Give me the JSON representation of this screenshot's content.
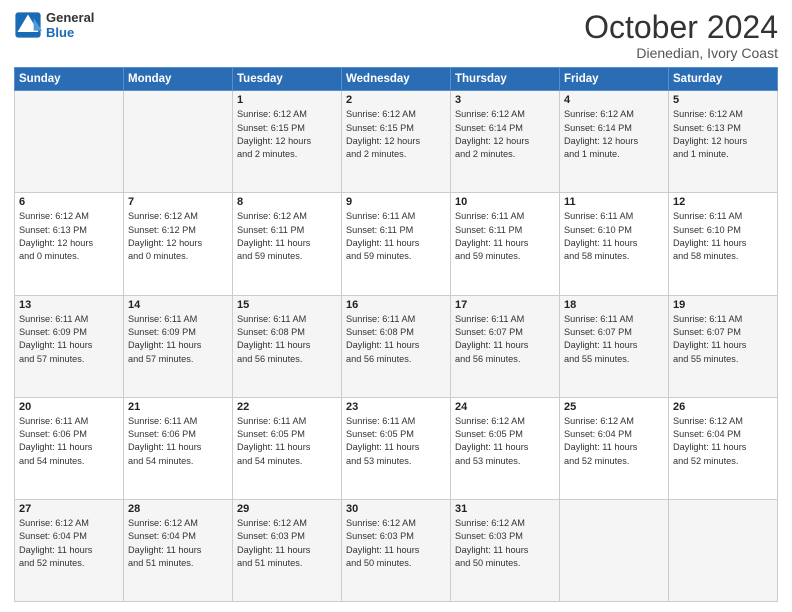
{
  "logo": {
    "text_general": "General",
    "text_blue": "Blue"
  },
  "header": {
    "title": "October 2024",
    "subtitle": "Dienedian, Ivory Coast"
  },
  "weekdays": [
    "Sunday",
    "Monday",
    "Tuesday",
    "Wednesday",
    "Thursday",
    "Friday",
    "Saturday"
  ],
  "rows": [
    [
      {
        "day": "",
        "info": ""
      },
      {
        "day": "",
        "info": ""
      },
      {
        "day": "1",
        "info": "Sunrise: 6:12 AM\nSunset: 6:15 PM\nDaylight: 12 hours\nand 2 minutes."
      },
      {
        "day": "2",
        "info": "Sunrise: 6:12 AM\nSunset: 6:15 PM\nDaylight: 12 hours\nand 2 minutes."
      },
      {
        "day": "3",
        "info": "Sunrise: 6:12 AM\nSunset: 6:14 PM\nDaylight: 12 hours\nand 2 minutes."
      },
      {
        "day": "4",
        "info": "Sunrise: 6:12 AM\nSunset: 6:14 PM\nDaylight: 12 hours\nand 1 minute."
      },
      {
        "day": "5",
        "info": "Sunrise: 6:12 AM\nSunset: 6:13 PM\nDaylight: 12 hours\nand 1 minute."
      }
    ],
    [
      {
        "day": "6",
        "info": "Sunrise: 6:12 AM\nSunset: 6:13 PM\nDaylight: 12 hours\nand 0 minutes."
      },
      {
        "day": "7",
        "info": "Sunrise: 6:12 AM\nSunset: 6:12 PM\nDaylight: 12 hours\nand 0 minutes."
      },
      {
        "day": "8",
        "info": "Sunrise: 6:12 AM\nSunset: 6:11 PM\nDaylight: 11 hours\nand 59 minutes."
      },
      {
        "day": "9",
        "info": "Sunrise: 6:11 AM\nSunset: 6:11 PM\nDaylight: 11 hours\nand 59 minutes."
      },
      {
        "day": "10",
        "info": "Sunrise: 6:11 AM\nSunset: 6:11 PM\nDaylight: 11 hours\nand 59 minutes."
      },
      {
        "day": "11",
        "info": "Sunrise: 6:11 AM\nSunset: 6:10 PM\nDaylight: 11 hours\nand 58 minutes."
      },
      {
        "day": "12",
        "info": "Sunrise: 6:11 AM\nSunset: 6:10 PM\nDaylight: 11 hours\nand 58 minutes."
      }
    ],
    [
      {
        "day": "13",
        "info": "Sunrise: 6:11 AM\nSunset: 6:09 PM\nDaylight: 11 hours\nand 57 minutes."
      },
      {
        "day": "14",
        "info": "Sunrise: 6:11 AM\nSunset: 6:09 PM\nDaylight: 11 hours\nand 57 minutes."
      },
      {
        "day": "15",
        "info": "Sunrise: 6:11 AM\nSunset: 6:08 PM\nDaylight: 11 hours\nand 56 minutes."
      },
      {
        "day": "16",
        "info": "Sunrise: 6:11 AM\nSunset: 6:08 PM\nDaylight: 11 hours\nand 56 minutes."
      },
      {
        "day": "17",
        "info": "Sunrise: 6:11 AM\nSunset: 6:07 PM\nDaylight: 11 hours\nand 56 minutes."
      },
      {
        "day": "18",
        "info": "Sunrise: 6:11 AM\nSunset: 6:07 PM\nDaylight: 11 hours\nand 55 minutes."
      },
      {
        "day": "19",
        "info": "Sunrise: 6:11 AM\nSunset: 6:07 PM\nDaylight: 11 hours\nand 55 minutes."
      }
    ],
    [
      {
        "day": "20",
        "info": "Sunrise: 6:11 AM\nSunset: 6:06 PM\nDaylight: 11 hours\nand 54 minutes."
      },
      {
        "day": "21",
        "info": "Sunrise: 6:11 AM\nSunset: 6:06 PM\nDaylight: 11 hours\nand 54 minutes."
      },
      {
        "day": "22",
        "info": "Sunrise: 6:11 AM\nSunset: 6:05 PM\nDaylight: 11 hours\nand 54 minutes."
      },
      {
        "day": "23",
        "info": "Sunrise: 6:11 AM\nSunset: 6:05 PM\nDaylight: 11 hours\nand 53 minutes."
      },
      {
        "day": "24",
        "info": "Sunrise: 6:12 AM\nSunset: 6:05 PM\nDaylight: 11 hours\nand 53 minutes."
      },
      {
        "day": "25",
        "info": "Sunrise: 6:12 AM\nSunset: 6:04 PM\nDaylight: 11 hours\nand 52 minutes."
      },
      {
        "day": "26",
        "info": "Sunrise: 6:12 AM\nSunset: 6:04 PM\nDaylight: 11 hours\nand 52 minutes."
      }
    ],
    [
      {
        "day": "27",
        "info": "Sunrise: 6:12 AM\nSunset: 6:04 PM\nDaylight: 11 hours\nand 52 minutes."
      },
      {
        "day": "28",
        "info": "Sunrise: 6:12 AM\nSunset: 6:04 PM\nDaylight: 11 hours\nand 51 minutes."
      },
      {
        "day": "29",
        "info": "Sunrise: 6:12 AM\nSunset: 6:03 PM\nDaylight: 11 hours\nand 51 minutes."
      },
      {
        "day": "30",
        "info": "Sunrise: 6:12 AM\nSunset: 6:03 PM\nDaylight: 11 hours\nand 50 minutes."
      },
      {
        "day": "31",
        "info": "Sunrise: 6:12 AM\nSunset: 6:03 PM\nDaylight: 11 hours\nand 50 minutes."
      },
      {
        "day": "",
        "info": ""
      },
      {
        "day": "",
        "info": ""
      }
    ]
  ]
}
